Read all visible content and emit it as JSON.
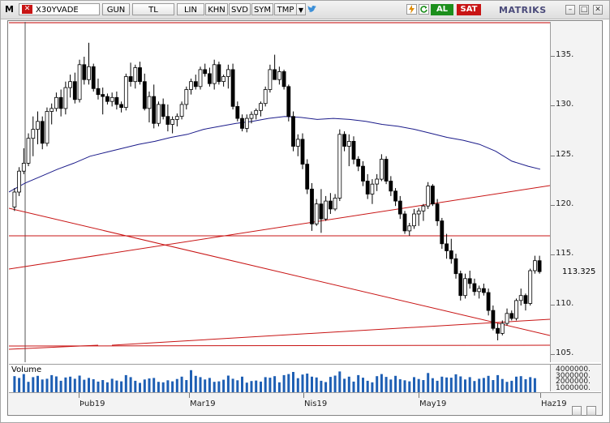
{
  "toolbar": {
    "symbol": "X30YVADE",
    "buttons": [
      {
        "id": "gun",
        "label": "GUN"
      },
      {
        "id": "tl",
        "label": "TL"
      },
      {
        "id": "lin",
        "label": "LIN"
      },
      {
        "id": "khn",
        "label": "KHN"
      },
      {
        "id": "svd",
        "label": "SVD"
      },
      {
        "id": "sym",
        "label": "SYM"
      },
      {
        "id": "tmp",
        "label": "TMP"
      }
    ],
    "buy_label": "AL",
    "sell_label": "SAT",
    "brand": "MATRIKS",
    "colors": {
      "buy": "#1c8f1c",
      "sell": "#c81414",
      "twitter": "#3b8fd8"
    }
  },
  "chart_data": {
    "type": "candlestick",
    "title": "",
    "y_ticks": [
      105,
      110,
      115,
      120,
      125,
      130,
      135
    ],
    "y_range": [
      104.2,
      138.4
    ],
    "last_price": "113.325",
    "x_labels": [
      "Þub19",
      "Mar19",
      "Nis19",
      "May19",
      "Haz19"
    ],
    "volume_label": "Volume",
    "volume_ticks": [
      "4000000.",
      "3000000.",
      "2000000.",
      "1000000."
    ],
    "candles": [
      [
        119.8,
        121.7,
        119.4,
        121.3
      ],
      [
        121.3,
        123.8,
        120.9,
        123.4
      ],
      [
        123.4,
        125.7,
        123.1,
        124.2
      ],
      [
        124.2,
        127.2,
        123.9,
        126.7
      ],
      [
        126.7,
        128.9,
        124.9,
        127.6
      ],
      [
        127.6,
        129.4,
        126.1,
        128.4
      ],
      [
        128.4,
        128.9,
        125.6,
        126.2
      ],
      [
        126.2,
        129.8,
        125.9,
        129.4
      ],
      [
        129.4,
        130.2,
        128.1,
        129.7
      ],
      [
        129.7,
        131.3,
        129.4,
        130.8
      ],
      [
        130.8,
        131.6,
        128.9,
        129.7
      ],
      [
        129.7,
        132.4,
        129.1,
        131.8
      ],
      [
        131.8,
        133.1,
        130.8,
        132.4
      ],
      [
        132.4,
        133.3,
        130.2,
        130.6
      ],
      [
        130.6,
        134.6,
        130.3,
        134.1
      ],
      [
        134.1,
        134.9,
        132.1,
        132.6
      ],
      [
        132.6,
        136.3,
        132.1,
        133.9
      ],
      [
        133.9,
        134.2,
        131.4,
        131.7
      ],
      [
        131.7,
        132.7,
        130.6,
        131.1
      ],
      [
        131.1,
        131.8,
        129.1,
        130.9
      ],
      [
        130.9,
        131.2,
        130.1,
        130.4
      ],
      [
        130.4,
        131.3,
        129.9,
        130.8
      ],
      [
        130.8,
        131.4,
        129.6,
        130.1
      ],
      [
        130.1,
        130.4,
        129.3,
        129.8
      ],
      [
        129.8,
        133.2,
        129.5,
        132.9
      ],
      [
        132.9,
        134.3,
        131.9,
        132.4
      ],
      [
        132.4,
        134.1,
        131.7,
        133.8
      ],
      [
        133.8,
        134.4,
        132.1,
        132.4
      ],
      [
        132.4,
        133.2,
        129.5,
        129.7
      ],
      [
        129.7,
        131.4,
        128.3,
        130.9
      ],
      [
        130.9,
        132.1,
        127.7,
        128.2
      ],
      [
        128.2,
        130.4,
        127.9,
        130.1
      ],
      [
        130.1,
        130.7,
        128.6,
        128.9
      ],
      [
        128.9,
        130.1,
        127.4,
        128.1
      ],
      [
        128.1,
        128.9,
        127.2,
        128.6
      ],
      [
        128.6,
        129.2,
        127.9,
        128.9
      ],
      [
        128.9,
        130.4,
        128.6,
        130.1
      ],
      [
        130.1,
        131.9,
        129.6,
        131.6
      ],
      [
        131.6,
        132.7,
        131.1,
        132.4
      ],
      [
        132.4,
        133.1,
        131.6,
        131.9
      ],
      [
        131.9,
        133.9,
        131.6,
        133.6
      ],
      [
        133.6,
        134.2,
        132.9,
        133.2
      ],
      [
        133.2,
        133.8,
        131.9,
        132.2
      ],
      [
        132.2,
        134.6,
        131.6,
        134.1
      ],
      [
        134.1,
        134.4,
        132.1,
        132.4
      ],
      [
        132.4,
        133.1,
        131.9,
        132.9
      ],
      [
        132.9,
        134.1,
        131.7,
        133.6
      ],
      [
        133.6,
        134.2,
        129.6,
        129.9
      ],
      [
        129.9,
        130.4,
        128.4,
        128.7
      ],
      [
        128.7,
        129.1,
        127.4,
        127.7
      ],
      [
        127.7,
        129.1,
        127.3,
        128.7
      ],
      [
        128.7,
        129.4,
        128.2,
        129.1
      ],
      [
        129.1,
        129.7,
        128.6,
        129.5
      ],
      [
        129.5,
        130.4,
        128.9,
        130.2
      ],
      [
        130.2,
        131.9,
        129.9,
        131.6
      ],
      [
        131.6,
        134.1,
        131.3,
        133.6
      ],
      [
        133.6,
        135.1,
        133.1,
        132.6
      ],
      [
        132.6,
        133.9,
        132.1,
        133.4
      ],
      [
        133.4,
        133.6,
        131.6,
        131.9
      ],
      [
        131.9,
        132.1,
        128.4,
        128.9
      ],
      [
        128.9,
        129.4,
        125.4,
        125.9
      ],
      [
        125.9,
        127.1,
        124.9,
        126.6
      ],
      [
        126.6,
        127.2,
        123.6,
        124.1
      ],
      [
        124.1,
        124.6,
        121.1,
        121.6
      ],
      [
        121.6,
        122.2,
        117.4,
        118.1
      ],
      [
        118.1,
        120.6,
        117.9,
        120.1
      ],
      [
        120.1,
        121.6,
        117.2,
        118.6
      ],
      [
        118.6,
        120.9,
        118.4,
        120.4
      ],
      [
        120.4,
        121.2,
        119.1,
        119.6
      ],
      [
        119.6,
        121.1,
        119.4,
        120.7
      ],
      [
        120.7,
        127.6,
        120.4,
        127.1
      ],
      [
        127.1,
        127.4,
        125.4,
        125.9
      ],
      [
        125.9,
        127.1,
        123.9,
        126.4
      ],
      [
        126.4,
        126.9,
        124.1,
        124.6
      ],
      [
        124.6,
        124.9,
        123.4,
        123.9
      ],
      [
        123.9,
        124.4,
        121.9,
        122.4
      ],
      [
        122.4,
        123.1,
        120.6,
        121.1
      ],
      [
        121.1,
        122.6,
        120.1,
        122.1
      ],
      [
        122.1,
        123.1,
        121.4,
        122.6
      ],
      [
        122.6,
        125.1,
        122.4,
        124.6
      ],
      [
        124.6,
        124.9,
        122.1,
        122.4
      ],
      [
        122.4,
        122.9,
        120.9,
        121.4
      ],
      [
        121.4,
        121.7,
        119.9,
        120.4
      ],
      [
        120.4,
        120.9,
        118.6,
        119.1
      ],
      [
        119.1,
        119.4,
        117.1,
        117.4
      ],
      [
        117.4,
        118.2,
        116.9,
        117.9
      ],
      [
        117.9,
        119.6,
        117.6,
        119.1
      ],
      [
        119.1,
        119.7,
        117.9,
        119.4
      ],
      [
        119.4,
        120.1,
        118.4,
        119.9
      ],
      [
        119.9,
        122.3,
        119.6,
        121.9
      ],
      [
        121.9,
        122.1,
        119.9,
        120.1
      ],
      [
        120.1,
        120.6,
        117.9,
        118.4
      ],
      [
        118.4,
        118.7,
        115.6,
        116.1
      ],
      [
        116.1,
        117.1,
        114.6,
        115.4
      ],
      [
        115.4,
        116.6,
        114.1,
        114.6
      ],
      [
        114.6,
        115.1,
        112.6,
        113.1
      ],
      [
        113.1,
        113.4,
        110.4,
        110.9
      ],
      [
        110.9,
        113.1,
        110.6,
        112.6
      ],
      [
        112.6,
        113.4,
        111.6,
        112.1
      ],
      [
        112.1,
        112.6,
        110.9,
        111.3
      ],
      [
        111.3,
        111.9,
        110.6,
        111.6
      ],
      [
        111.6,
        112.1,
        110.9,
        111.2
      ],
      [
        111.2,
        111.6,
        108.9,
        109.4
      ],
      [
        109.4,
        109.9,
        107.4,
        107.6
      ],
      [
        107.6,
        108.1,
        106.4,
        107.1
      ],
      [
        107.1,
        108.4,
        106.9,
        108.1
      ],
      [
        108.1,
        109.6,
        107.9,
        109.1
      ],
      [
        109.1,
        109.4,
        108.4,
        108.6
      ],
      [
        108.6,
        110.6,
        108.4,
        110.4
      ],
      [
        110.4,
        111.6,
        109.9,
        110.9
      ],
      [
        110.9,
        111.1,
        109.4,
        110.1
      ],
      [
        110.1,
        113.6,
        109.9,
        113.4
      ],
      [
        113.4,
        114.9,
        113.1,
        114.4
      ],
      [
        114.4,
        114.9,
        113.1,
        113.3
      ]
    ],
    "volume": [
      62,
      55,
      70,
      40,
      58,
      63,
      49,
      52,
      66,
      61,
      44,
      57,
      60,
      52,
      64,
      48,
      55,
      50,
      41,
      47,
      38,
      52,
      45,
      42,
      66,
      58,
      44,
      36,
      49,
      53,
      55,
      40,
      38,
      46,
      42,
      51,
      60,
      47,
      85,
      63,
      58,
      49,
      55,
      40,
      42,
      48,
      64,
      52,
      46,
      60,
      37,
      43,
      45,
      41,
      58,
      56,
      62,
      38,
      66,
      70,
      78,
      54,
      68,
      72,
      60,
      57,
      44,
      39,
      59,
      64,
      80,
      52,
      60,
      41,
      66,
      56,
      44,
      38,
      62,
      70,
      59,
      49,
      63,
      50,
      46,
      42,
      58,
      51,
      47,
      74,
      54,
      44,
      60,
      57,
      56,
      69,
      61,
      49,
      58,
      43,
      52,
      55,
      63,
      47,
      66,
      51,
      40,
      44,
      60,
      62,
      50,
      58,
      54
    ],
    "moving_average": [
      [
        0,
        121.3
      ],
      [
        20,
        122.2
      ],
      [
        40,
        122.9
      ],
      [
        60,
        123.6
      ],
      [
        80,
        124.2
      ],
      [
        100,
        124.9
      ],
      [
        120,
        125.3
      ],
      [
        140,
        125.7
      ],
      [
        160,
        126.1
      ],
      [
        180,
        126.4
      ],
      [
        200,
        126.8
      ],
      [
        220,
        127.1
      ],
      [
        240,
        127.6
      ],
      [
        260,
        127.9
      ],
      [
        280,
        128.2
      ],
      [
        300,
        128.4
      ],
      [
        320,
        128.7
      ],
      [
        340,
        128.9
      ],
      [
        360,
        128.8
      ],
      [
        380,
        128.6
      ],
      [
        400,
        128.7
      ],
      [
        420,
        128.6
      ],
      [
        440,
        128.4
      ],
      [
        460,
        128.1
      ],
      [
        480,
        127.9
      ],
      [
        500,
        127.6
      ],
      [
        520,
        127.2
      ],
      [
        540,
        126.8
      ],
      [
        560,
        126.5
      ],
      [
        580,
        126.1
      ],
      [
        600,
        125.4
      ],
      [
        620,
        124.4
      ],
      [
        640,
        123.9
      ],
      [
        655,
        123.6
      ]
    ]
  }
}
